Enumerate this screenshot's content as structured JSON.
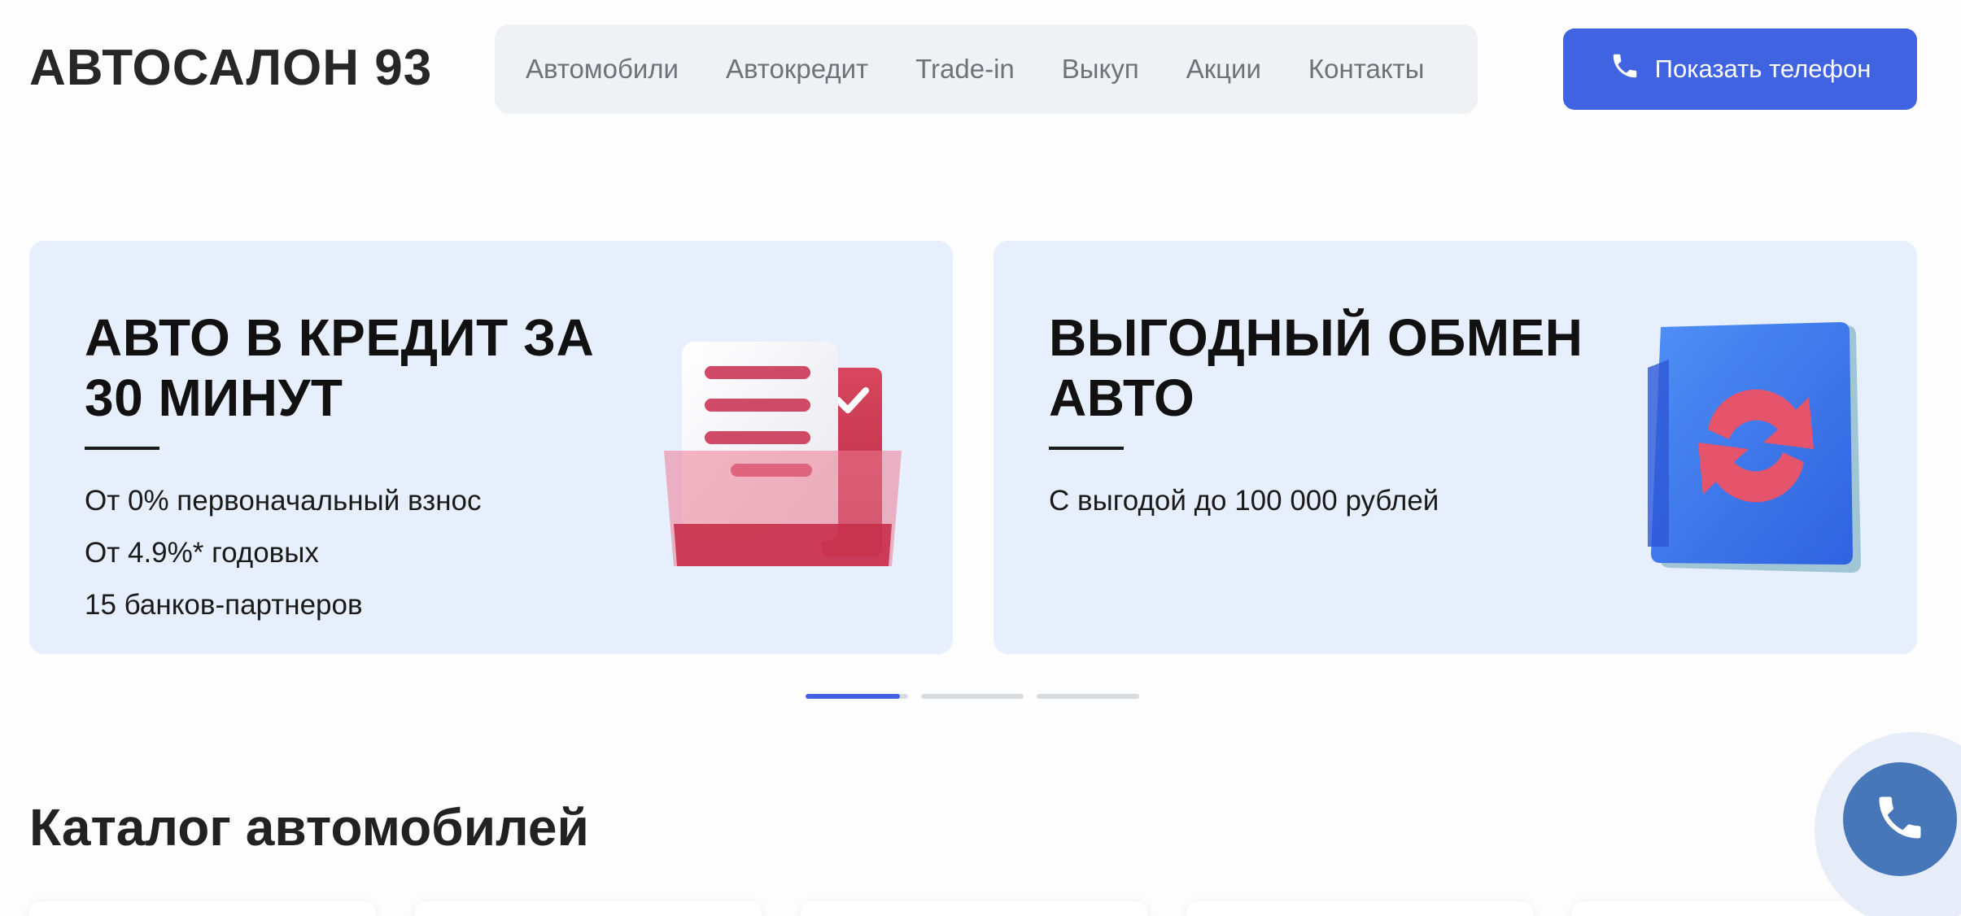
{
  "brand": {
    "logo": "АВТОСАЛОН 93"
  },
  "nav": {
    "items": [
      {
        "label": "Автомобили"
      },
      {
        "label": "Автокредит"
      },
      {
        "label": "Trade-in"
      },
      {
        "label": "Выкуп"
      },
      {
        "label": "Акции"
      },
      {
        "label": "Контакты"
      }
    ]
  },
  "header": {
    "phone_button_label": "Показать телефон",
    "phone_icon": "phone-icon"
  },
  "promos": [
    {
      "title_line1": "АВТО В КРЕДИТ ЗА",
      "title_line2": "30 МИНУТ",
      "lines": [
        "От 0% первоначальный взнос",
        "От 4.9%* годовых",
        "15 банков-партнеров"
      ],
      "icon": "document-folder-icon"
    },
    {
      "title_line1": "ВЫГОДНЫЙ ОБМЕН",
      "title_line2": "АВТО",
      "lines": [
        "С выгодой до 100 000 рублей"
      ],
      "icon": "exchange-arrows-icon"
    }
  ],
  "slider": {
    "slides": 3,
    "active_index": 0,
    "active_progress": 0.92
  },
  "catalog": {
    "title": "Каталог автомобилей"
  },
  "colors": {
    "accent": "#3f63e1",
    "card_bg": "#e7eefc",
    "nav_bg": "#eff1f4",
    "float_button": "#4777b8",
    "illus_red": "#c8334f"
  }
}
